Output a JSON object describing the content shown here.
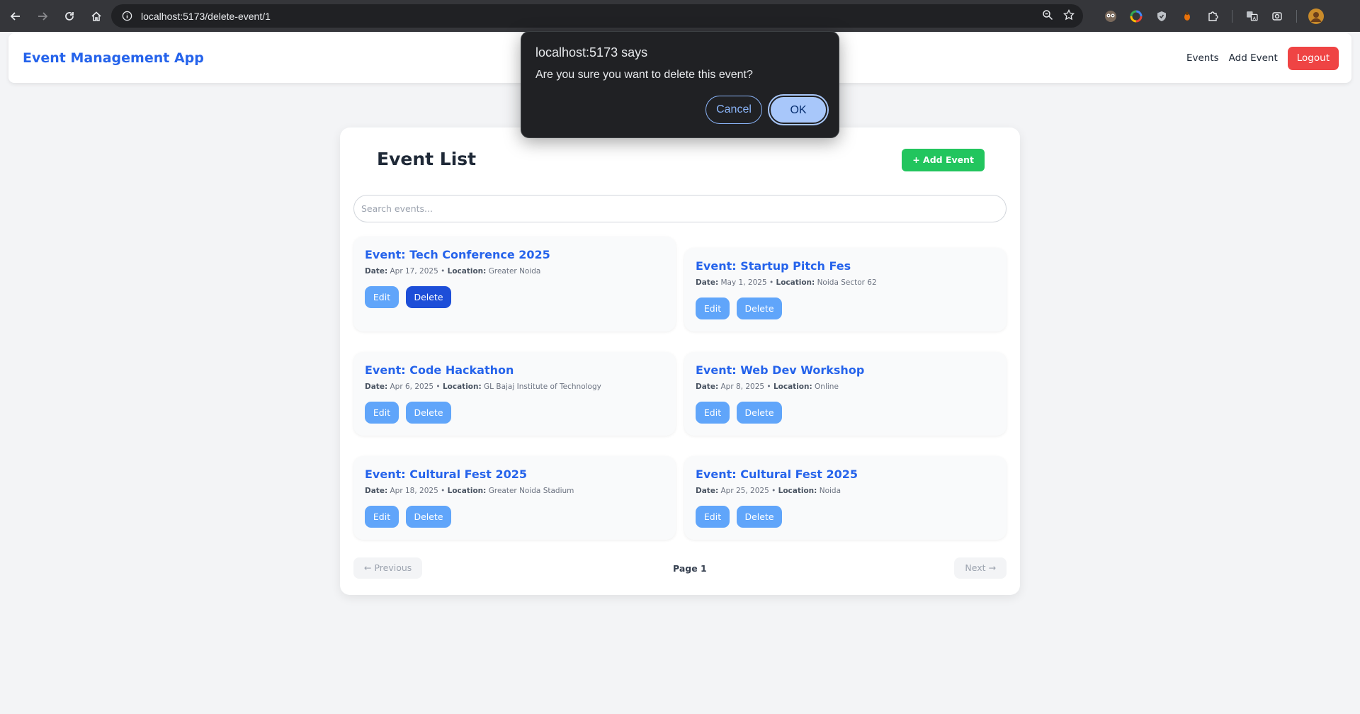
{
  "browser": {
    "url": "localhost:5173/delete-event/1"
  },
  "navbar": {
    "brand": "Event Management App",
    "links": [
      "Events",
      "Add Event"
    ],
    "logout": "Logout"
  },
  "main": {
    "title": "Event List",
    "add_button": "+ Add Event",
    "search_placeholder": "Search events...",
    "date_label": "Date:",
    "location_label": "Location:",
    "edit_label": "Edit",
    "delete_label": "Delete",
    "events": [
      {
        "title": "Event: Tech Conference 2025",
        "date": "Apr 17, 2025",
        "location": "Greater Noida"
      },
      {
        "title": "Event: Startup Pitch Fes",
        "date": "May 1, 2025",
        "location": "Noida Sector 62"
      },
      {
        "title": "Event: Code Hackathon",
        "date": "Apr 6, 2025",
        "location": "GL Bajaj Institute of Technology"
      },
      {
        "title": "Event: Web Dev Workshop",
        "date": "Apr 8, 2025",
        "location": "Online"
      },
      {
        "title": "Event: Cultural Fest 2025",
        "date": "Apr 18, 2025",
        "location": "Greater Noida Stadium"
      },
      {
        "title": "Event: Cultural Fest 2025",
        "date": "Apr 25, 2025",
        "location": "Noida"
      }
    ],
    "pagination": {
      "previous": "← Previous",
      "page": "Page 1",
      "next": "Next →"
    }
  },
  "dialog": {
    "title": "localhost:5173 says",
    "message": "Are you sure you want to delete this event?",
    "cancel": "Cancel",
    "ok": "OK"
  }
}
